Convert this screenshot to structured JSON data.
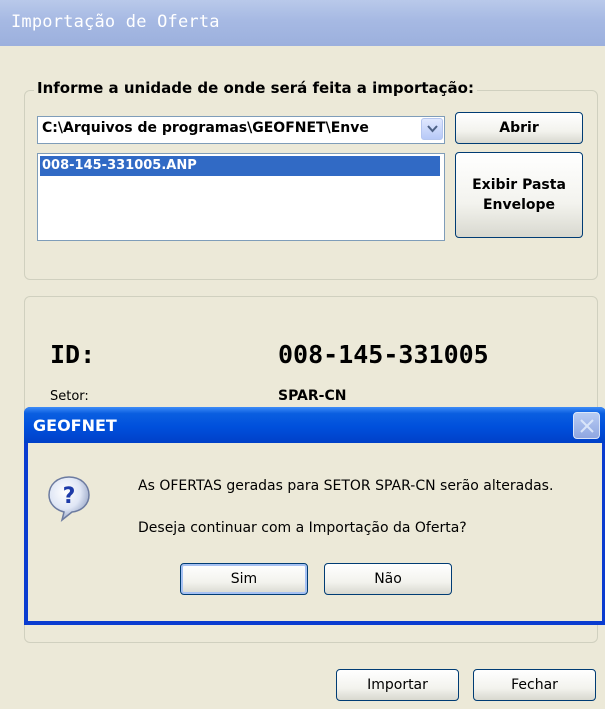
{
  "window": {
    "title": "Importação de Oferta"
  },
  "import_group": {
    "legend": "Informe a unidade de onde será feita a importação:",
    "path_value": "C:\\Arquivos de programas\\GEOFNET\\Enve",
    "file_list": [
      "008-145-331005.ANP"
    ],
    "open_button": "Abrir",
    "show_folder_button_line1": "Exibir Pasta",
    "show_folder_button_line2": "Envelope"
  },
  "info": {
    "id_label": "ID:",
    "id_value": "008-145-331005",
    "setor_label": "Setor:",
    "setor_value": "SPAR-CN"
  },
  "footer": {
    "import_button": "Importar",
    "close_button": "Fechar"
  },
  "dialog": {
    "title": "GEOFNET",
    "icon": "question-icon",
    "message_line1": "As OFERTAS geradas para SETOR SPAR-CN serão alteradas.",
    "message_line2": "Deseja continuar com a Importação da Oferta?",
    "yes_button": "Sim",
    "no_button": "Não"
  },
  "colors": {
    "titlebar": "#a6b9e3",
    "selection": "#316ac5",
    "dialog_titlebar": "#0050dc",
    "window_bg": "#ece9d8"
  }
}
